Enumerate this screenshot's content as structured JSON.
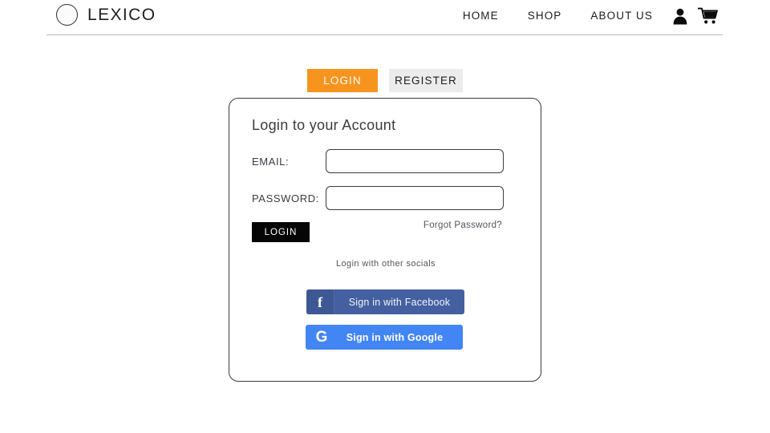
{
  "header": {
    "brand_name": "LEXICO",
    "logo_icon": "circle-logo-icon",
    "nav_links": [
      {
        "label": "HOME"
      },
      {
        "label": "SHOP"
      },
      {
        "label": "ABOUT US"
      }
    ],
    "account_icon": "user-icon",
    "cart_icon": "shopping-cart-icon"
  },
  "tabs": [
    {
      "label": "LOGIN",
      "active": true,
      "color": "#f7941e"
    },
    {
      "label": "REGISTER",
      "active": false,
      "color": "#ececec"
    }
  ],
  "card": {
    "title": "Login to your Account",
    "email": {
      "label": "EMAIL:",
      "value": "",
      "placeholder": ""
    },
    "password": {
      "label": "PASSWORD:",
      "value": "",
      "placeholder": ""
    },
    "login_button": "LOGIN",
    "forgot_password": "Forgot Password?",
    "socials_label": "Login with other socials",
    "social_buttons": [
      {
        "label": "Sign in with Facebook",
        "icon": "facebook-icon",
        "glyph": "f",
        "color": "#4460a0"
      },
      {
        "label": "Sign in with Google",
        "icon": "google-icon",
        "glyph": "G",
        "color": "#4285f4"
      }
    ]
  }
}
